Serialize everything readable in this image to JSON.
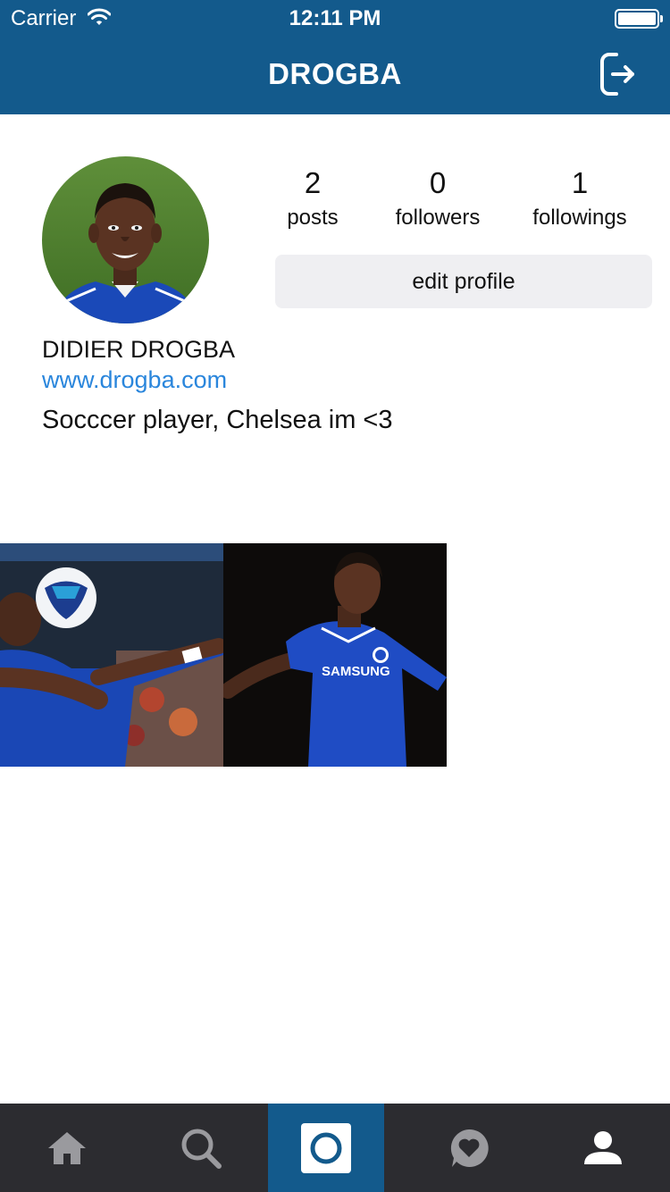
{
  "status_bar": {
    "carrier": "Carrier",
    "time": "12:11 PM",
    "wifi_icon": "wifi-icon",
    "battery_icon": "battery-icon"
  },
  "nav": {
    "title": "DROGBA",
    "logout_icon": "logout-icon"
  },
  "profile": {
    "avatar_icon": "avatar-photo",
    "stats": [
      {
        "value": "2",
        "label": "posts"
      },
      {
        "value": "0",
        "label": "followers"
      },
      {
        "value": "1",
        "label": "followings"
      }
    ],
    "edit_button_label": "edit profile",
    "name": "DIDIER DROGBA",
    "website": "www.drogba.com",
    "bio": "Socccer player, Chelsea im <3"
  },
  "posts": [
    {
      "icon": "photo-thumbnail"
    },
    {
      "icon": "photo-thumbnail"
    }
  ],
  "tabbar": {
    "tabs": [
      {
        "icon": "home-icon",
        "active": false
      },
      {
        "icon": "search-icon",
        "active": false
      },
      {
        "icon": "camera-icon",
        "active": true
      },
      {
        "icon": "heart-bubble-icon",
        "active": false
      },
      {
        "icon": "profile-icon",
        "active": false
      }
    ]
  },
  "colors": {
    "brand": "#135a8c",
    "tabbar_bg": "#2c2c30",
    "link": "#2a86dc",
    "button_bg": "#efeff2"
  }
}
